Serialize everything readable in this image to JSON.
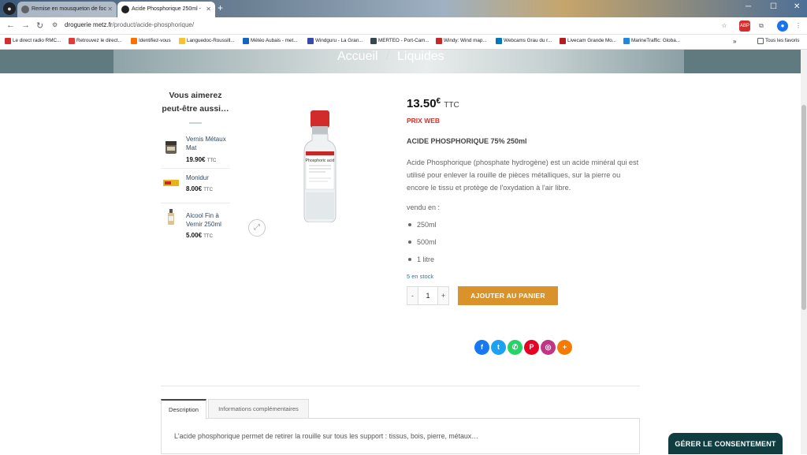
{
  "browser": {
    "tabs": [
      {
        "label": "Remise en mousqueton de foc"
      },
      {
        "label": "Acide Phosphorique 250ml -"
      }
    ],
    "url_domain": "droguerie metz.fr",
    "url_path": "/product/acide-phosphorique/",
    "bookmarks": [
      {
        "label": "Le direct radio RMC...",
        "color": "#d32f2f"
      },
      {
        "label": "Retrouvez le direct...",
        "color": "#e53935"
      },
      {
        "label": "Identifiez-vous",
        "color": "#ff6f00"
      },
      {
        "label": "Languedoc-Roussill...",
        "color": "#fbc02d"
      },
      {
        "label": "Météo Aubais - met...",
        "color": "#1565c0"
      },
      {
        "label": "Windguru - La Gran...",
        "color": "#3949ab"
      },
      {
        "label": "MERTEO - Port-Cam...",
        "color": "#37474f"
      },
      {
        "label": "Windy: Wind map...",
        "color": "#c62828"
      },
      {
        "label": "Webcams Grau du r...",
        "color": "#0277bd"
      },
      {
        "label": "Livecam Grande Mo...",
        "color": "#b71c1c"
      },
      {
        "label": "MarineTraffic: Globa...",
        "color": "#1e88e5"
      }
    ],
    "all_bookmarks": "Tous les favoris"
  },
  "hero": {
    "home": "Accueil",
    "separator": "/",
    "category": "Liquides"
  },
  "sidebar": {
    "title": "Vous aimerez peut-être aussi…",
    "items": [
      {
        "name": "Vernis Métaux Mat",
        "price": "19.90€",
        "ttc": "TTC"
      },
      {
        "name": "Monidur",
        "price": "8.00€",
        "ttc": "TTC"
      },
      {
        "name": "Alcool Fin à Vernir 250ml",
        "price": "5.00€",
        "ttc": "TTC"
      }
    ]
  },
  "product": {
    "price_value": "13.50",
    "price_currency": "€",
    "price_ttc": "TTC",
    "web_label": "PRIX WEB",
    "name": "ACIDE PHOSPHORIQUE 75% 250ml",
    "description": "Acide Phosphorique (phosphate hydrogène) est un acide minéral qui est utilisé pour enlever la rouille de pièces métalliques, sur la pierre ou encore le tissu et protège de l'oxydation à l'air libre.",
    "vendu_label": "vendu en :",
    "sizes": [
      "250ml",
      "500ml",
      "1 litre"
    ],
    "stock": "5 en stock",
    "quantity": "1",
    "minus": "-",
    "plus": "+",
    "add_to_cart": "AJOUTER AU PANIER",
    "bottle_label": "Phosphoric acid"
  },
  "share": {
    "icons": [
      "facebook-icon",
      "twitter-icon",
      "whatsapp-icon",
      "pinterest-icon",
      "instagram-icon",
      "more-share-icon"
    ],
    "colors": [
      "#1877f2",
      "#1da1f2",
      "#25d366",
      "#e60023",
      "#c13584",
      "#f57c00"
    ]
  },
  "product_tabs": [
    {
      "label": "Description"
    },
    {
      "label": "Informations complémentaires"
    }
  ],
  "tab_content": "L'acide phosphorique permet de retirer la rouille sur tous les support : tissus, bois, pierre, métaux…",
  "consent_button": "GÉRER LE CONSENTEMENT"
}
